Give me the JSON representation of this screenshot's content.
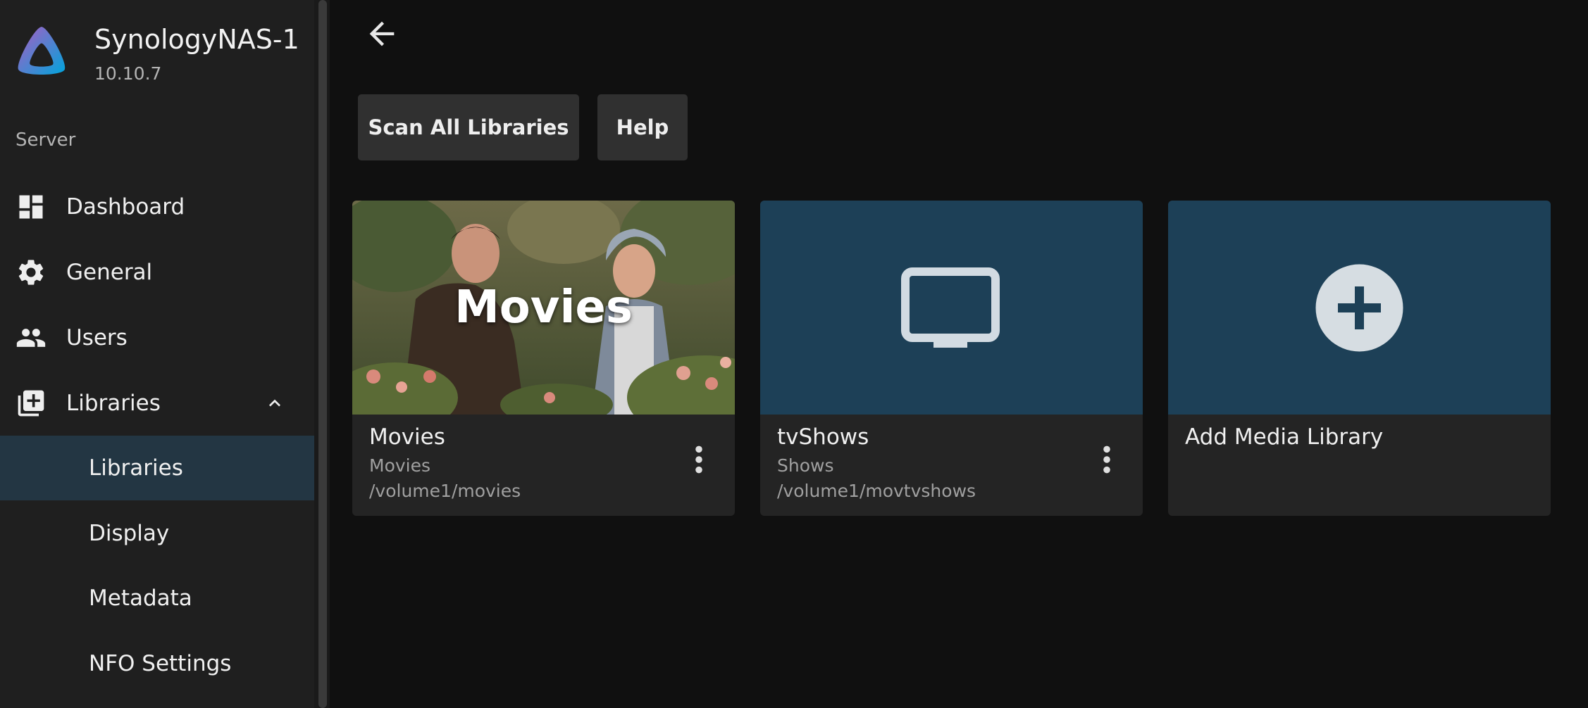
{
  "server": {
    "name": "SynologyNAS-1",
    "version": "10.10.7"
  },
  "sidebar": {
    "section_label": "Server",
    "items": [
      {
        "label": "Dashboard",
        "icon": "dashboard-icon"
      },
      {
        "label": "General",
        "icon": "gear-icon"
      },
      {
        "label": "Users",
        "icon": "users-icon"
      },
      {
        "label": "Libraries",
        "icon": "library-add-icon",
        "expanded": true
      }
    ],
    "sub_items": [
      {
        "label": "Libraries",
        "active": true
      },
      {
        "label": "Display",
        "active": false
      },
      {
        "label": "Metadata",
        "active": false
      },
      {
        "label": "NFO Settings",
        "active": false
      }
    ]
  },
  "toolbar": {
    "scan_label": "Scan All Libraries",
    "help_label": "Help"
  },
  "libraries": [
    {
      "overlay_title": "Movies",
      "name": "Movies",
      "type": "Movies",
      "path": "/volume1/movies",
      "image": "movie-still"
    },
    {
      "name": "tvShows",
      "type": "Shows",
      "path": "/volume1/movtvshows",
      "icon": "tv-icon"
    },
    {
      "name": "Add Media Library",
      "icon": "add-circle-icon"
    }
  ],
  "colors": {
    "accent_active": "#233643",
    "card_blue": "#1d4057",
    "background": "#101010",
    "sidebar": "#1f1f1f"
  }
}
